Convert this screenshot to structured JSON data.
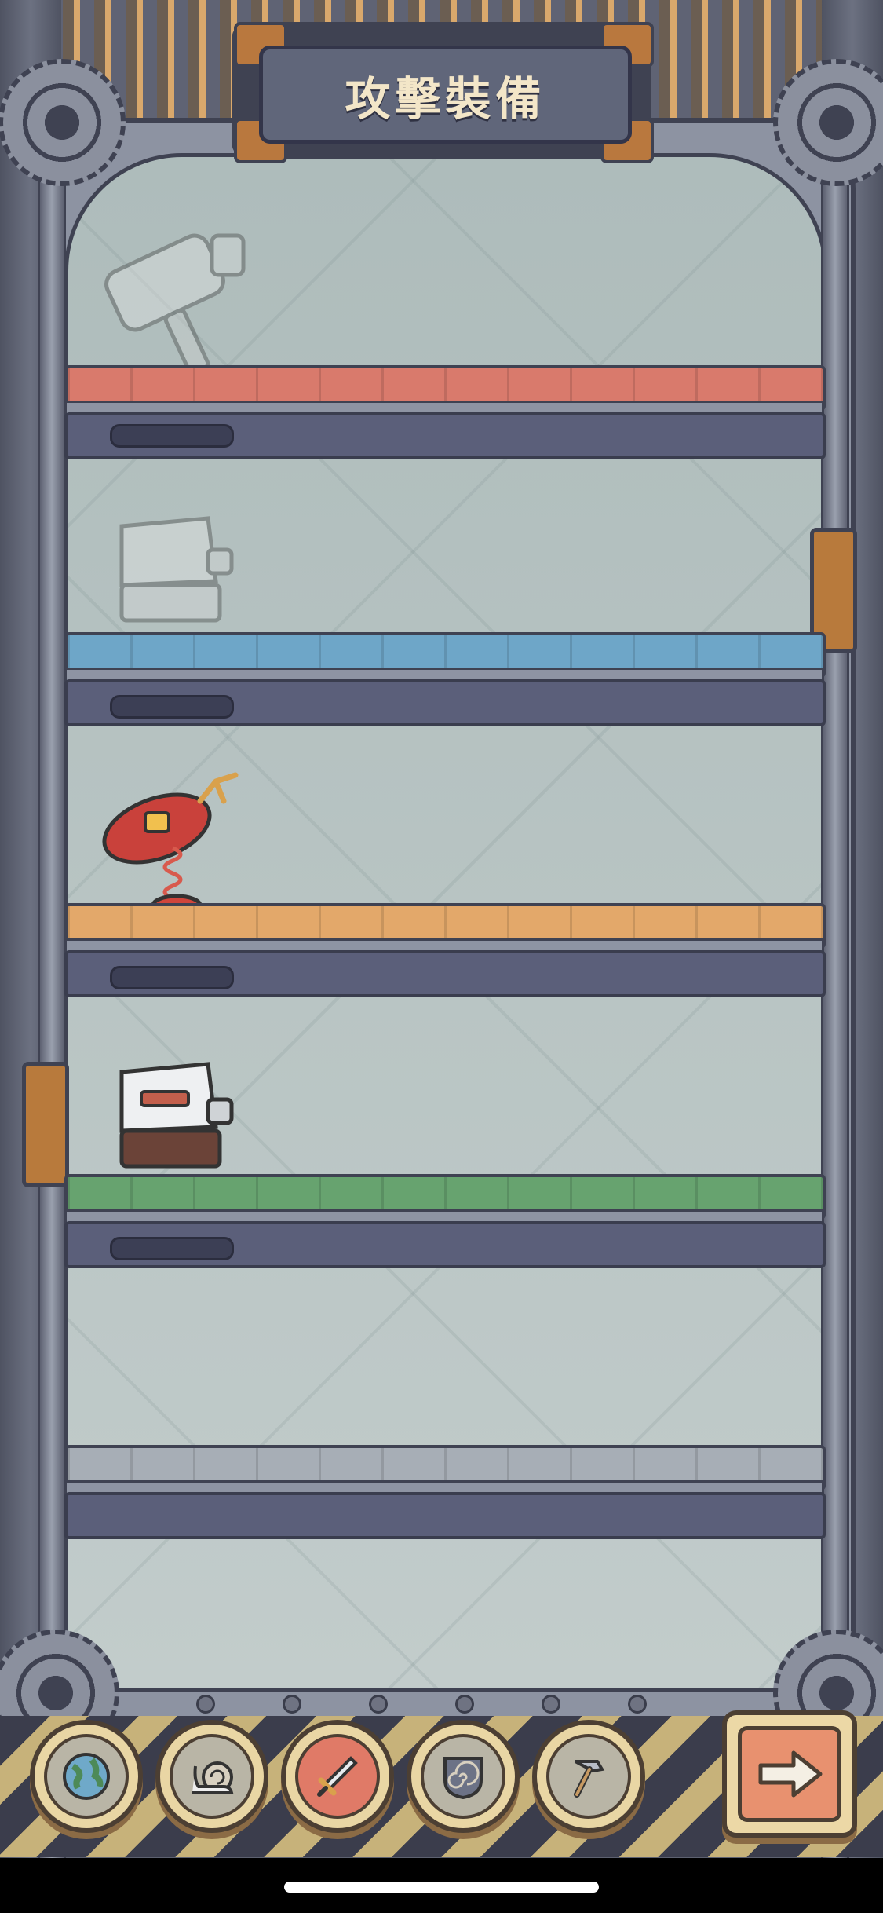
{
  "header": {
    "title": "攻擊裝備"
  },
  "shelves": [
    {
      "color": "#d97a6c",
      "item": "hammer-icon",
      "unlocked": false,
      "progress": 0.0
    },
    {
      "color": "#6ea6c8",
      "item": "stone-block-icon",
      "unlocked": false,
      "progress": 0.0
    },
    {
      "color": "#e3a86a",
      "item": "spring-bomb-icon",
      "unlocked": true,
      "progress": 0.0
    },
    {
      "color": "#67a36f",
      "item": "armored-block-icon",
      "unlocked": true,
      "progress": 0.0
    },
    {
      "color": "#a7aeb6",
      "item": "",
      "unlocked": false,
      "progress": 0.0
    }
  ],
  "toolbar": {
    "items": [
      {
        "icon": "globe-icon",
        "active": false
      },
      {
        "icon": "snail-icon",
        "active": false
      },
      {
        "icon": "sword-icon",
        "active": true
      },
      {
        "icon": "spiral-shield-icon",
        "active": false
      },
      {
        "icon": "hammer-tool-icon",
        "active": false
      }
    ],
    "next": {
      "icon": "arrow-right-icon"
    }
  },
  "colors": {
    "accent": "#e07a67",
    "frame": "#3f4252",
    "glass": "#b7c4c3"
  }
}
